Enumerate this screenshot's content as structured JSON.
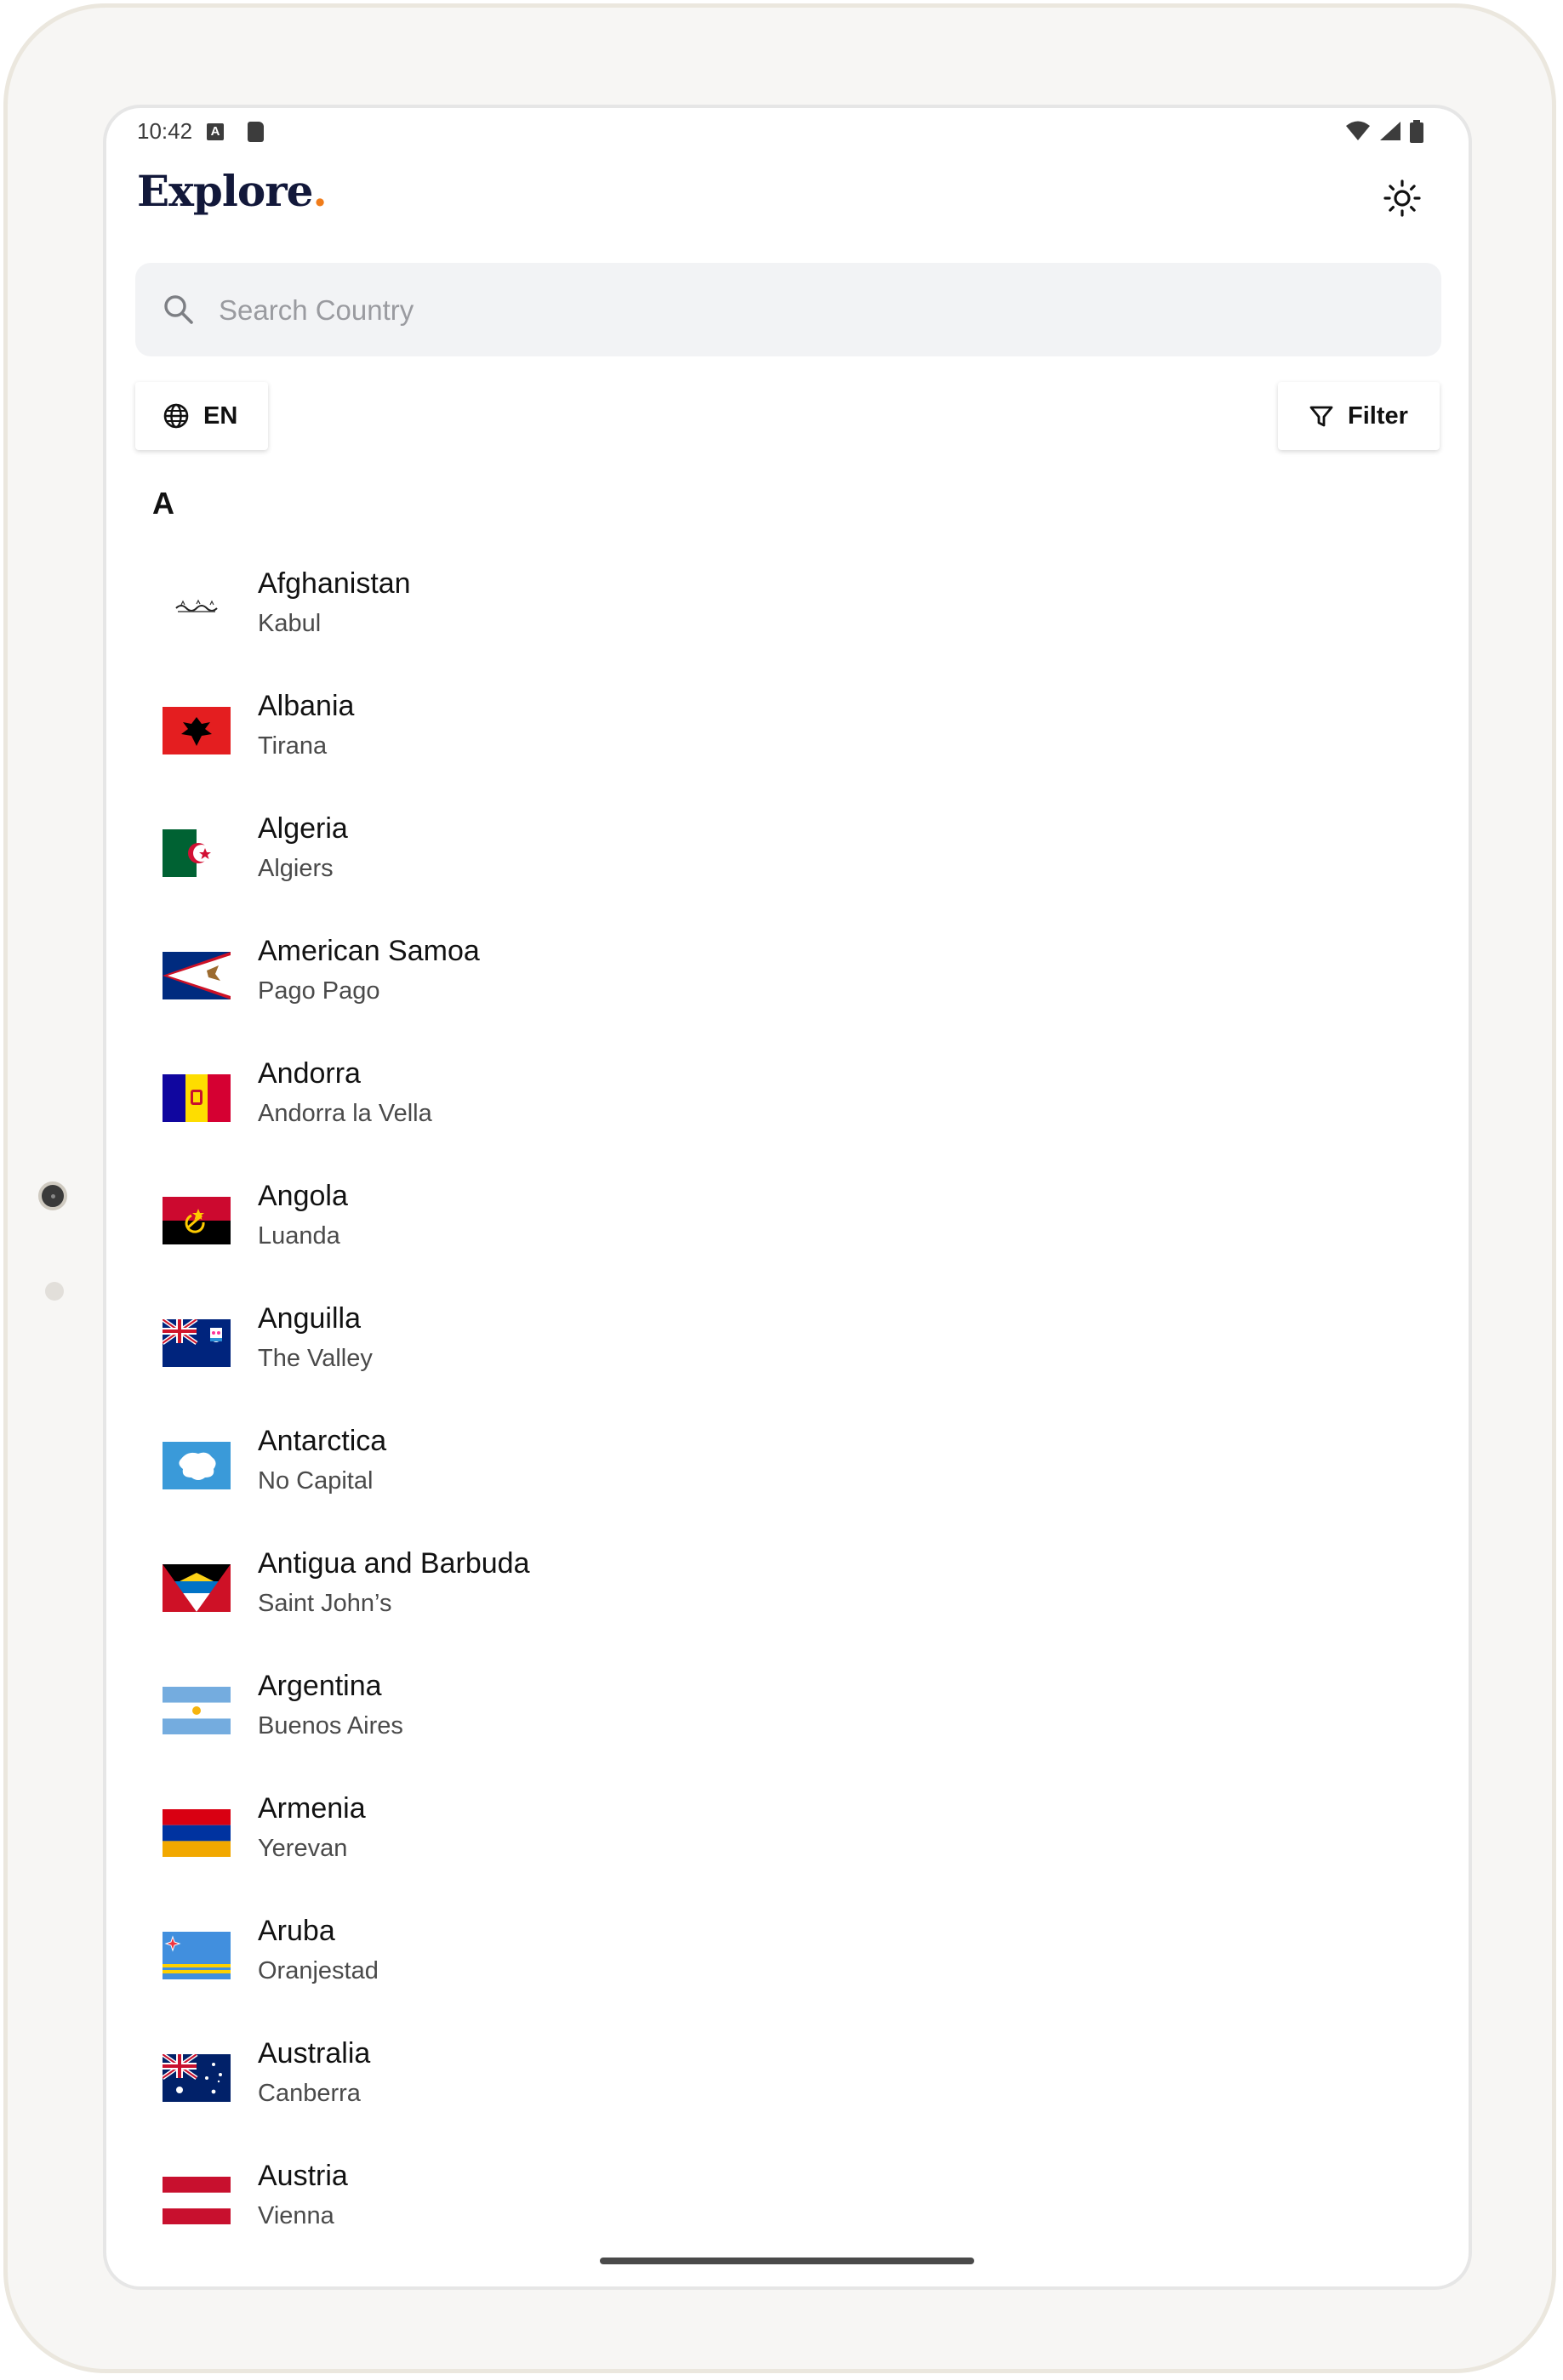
{
  "status_bar": {
    "time": "10:42",
    "a_badge": "A"
  },
  "header": {
    "logo_text": "Explore",
    "logo_dot": ".",
    "theme_toggle_icon": "sun-icon"
  },
  "search": {
    "placeholder": "Search Country",
    "value": ""
  },
  "controls": {
    "language_label": "EN",
    "filter_label": "Filter"
  },
  "section_letter": "A",
  "countries": [
    {
      "name": "Afghanistan",
      "capital": "Kabul",
      "flag": "afghanistan"
    },
    {
      "name": "Albania",
      "capital": "Tirana",
      "flag": "albania"
    },
    {
      "name": "Algeria",
      "capital": "Algiers",
      "flag": "algeria"
    },
    {
      "name": "American Samoa",
      "capital": "Pago Pago",
      "flag": "american-samoa"
    },
    {
      "name": "Andorra",
      "capital": "Andorra la Vella",
      "flag": "andorra"
    },
    {
      "name": "Angola",
      "capital": "Luanda",
      "flag": "angola"
    },
    {
      "name": "Anguilla",
      "capital": "The Valley",
      "flag": "anguilla"
    },
    {
      "name": "Antarctica",
      "capital": "No Capital",
      "flag": "antarctica"
    },
    {
      "name": "Antigua and Barbuda",
      "capital": "Saint John’s",
      "flag": "antigua-and-barbuda"
    },
    {
      "name": "Argentina",
      "capital": "Buenos Aires",
      "flag": "argentina"
    },
    {
      "name": "Armenia",
      "capital": "Yerevan",
      "flag": "armenia"
    },
    {
      "name": "Aruba",
      "capital": "Oranjestad",
      "flag": "aruba"
    },
    {
      "name": "Australia",
      "capital": "Canberra",
      "flag": "australia"
    },
    {
      "name": "Austria",
      "capital": "Vienna",
      "flag": "austria"
    }
  ],
  "colors": {
    "logo": "#12183a",
    "accent": "#f07c1a",
    "search_bg": "#f2f3f5"
  }
}
